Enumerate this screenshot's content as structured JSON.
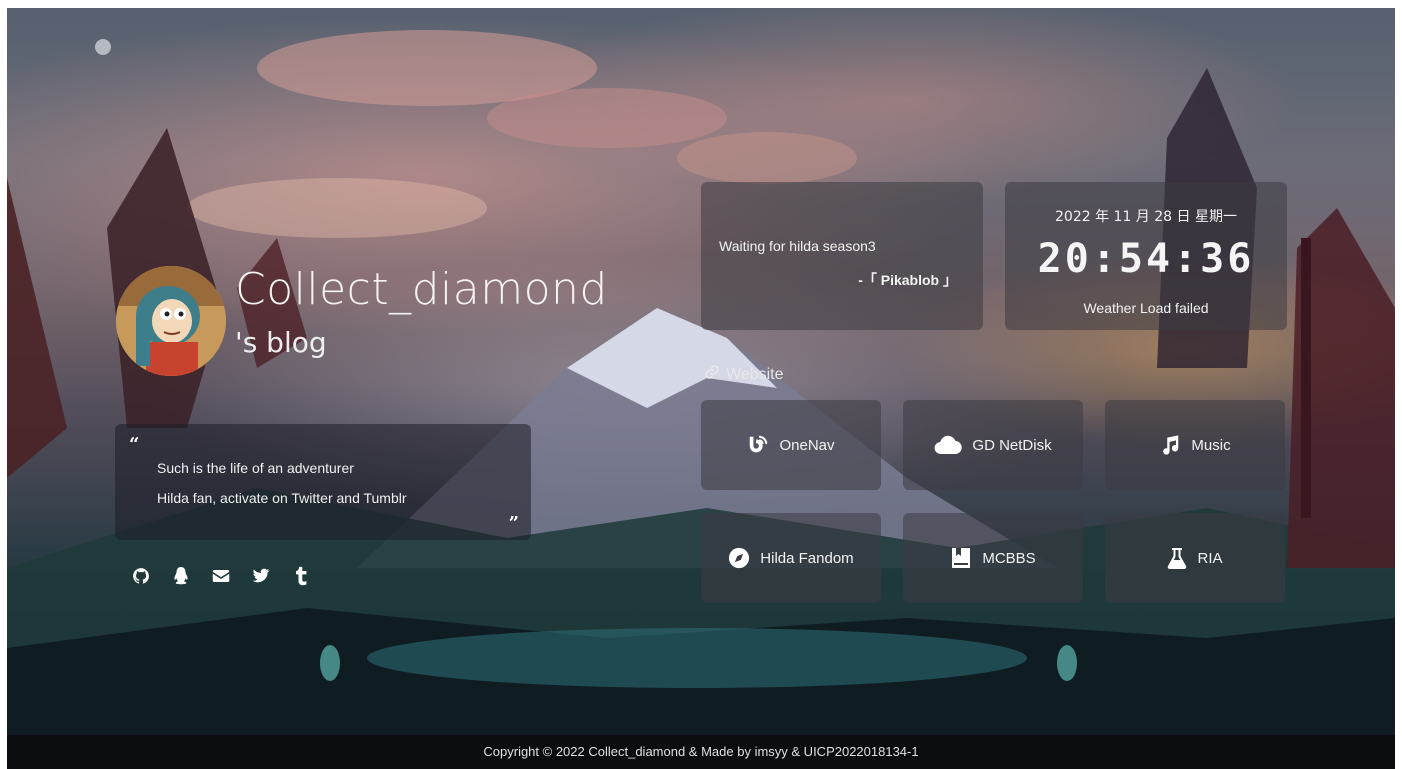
{
  "profile": {
    "name": "Collect_diamond",
    "subtitle": "'s blog"
  },
  "quote": {
    "open_mark": "“",
    "close_mark": "”",
    "line1": "Such is the life of an adventurer",
    "line2": "Hilda fan, activate on Twitter and Tumblr"
  },
  "socials": [
    {
      "icon": "github-icon"
    },
    {
      "icon": "qq-icon"
    },
    {
      "icon": "mail-icon"
    },
    {
      "icon": "twitter-icon"
    },
    {
      "icon": "tumblr-icon"
    }
  ],
  "hitokoto": {
    "text": "Waiting for hilda season3",
    "from": "-「 Pikablob 」"
  },
  "timebox": {
    "date": "2022 年 11 月 28 日 星期一",
    "time": "20:54:36",
    "weather": "Weather Load failed"
  },
  "links_section": {
    "title": "Website",
    "icon": "link-icon"
  },
  "links": [
    {
      "label": "OneNav",
      "icon": "onenav-icon"
    },
    {
      "label": "GD NetDisk",
      "icon": "cloud-icon"
    },
    {
      "label": "Music",
      "icon": "music-icon"
    },
    {
      "label": "Hilda Fandom",
      "icon": "compass-icon"
    },
    {
      "label": "MCBBS",
      "icon": "bookmark-book-icon"
    },
    {
      "label": "RIA",
      "icon": "flask-icon"
    }
  ],
  "footer": {
    "text": "Copyright © 2022 Collect_diamond & Made by imsyy & UICP2022018134-1"
  },
  "colors": {
    "panel": "#3c3a42",
    "text": "#f2f2f2"
  }
}
